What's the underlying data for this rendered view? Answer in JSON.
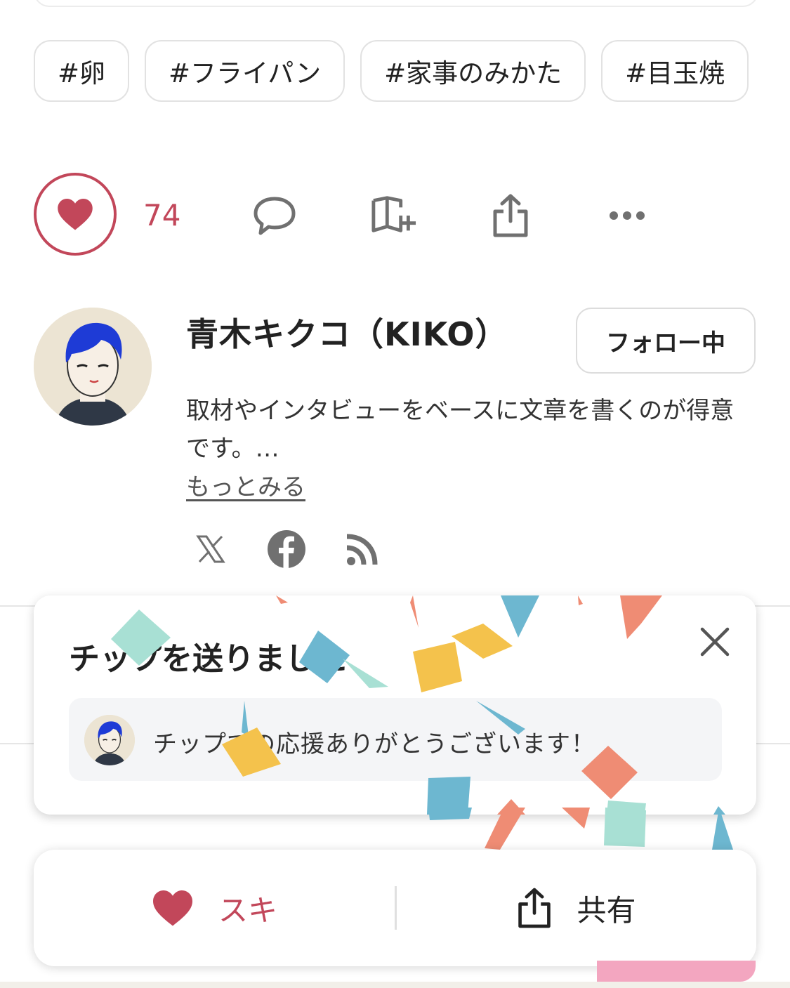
{
  "hashtags": [
    "#卵",
    "#フライパン",
    "#家事のみかた",
    "#目玉焼"
  ],
  "actions": {
    "like_count": "74",
    "like_icon": "heart-icon",
    "comment_icon": "comment-icon",
    "magazine_icon": "magazine-add-icon",
    "share_icon": "share-icon",
    "more_icon": "more-icon"
  },
  "creator": {
    "name": "青木キクコ（KIKO）",
    "follow_label": "フォロー中",
    "bio": "取材やインタビューをベースに文章を書くのが得意です。…",
    "more_label": "もっとみる",
    "social_icons": [
      "x-icon",
      "facebook-icon",
      "rss-icon"
    ]
  },
  "tip_dialog": {
    "title": "チップを送りました",
    "message": "チップでの応援ありがとうございます！",
    "close_icon": "close-icon"
  },
  "bottom_bar": {
    "like_label": "スキ",
    "share_label": "共有"
  },
  "colors": {
    "accent": "#c2475a",
    "text": "#222222",
    "border": "#e2e2e2",
    "icon_gray": "#707070"
  }
}
